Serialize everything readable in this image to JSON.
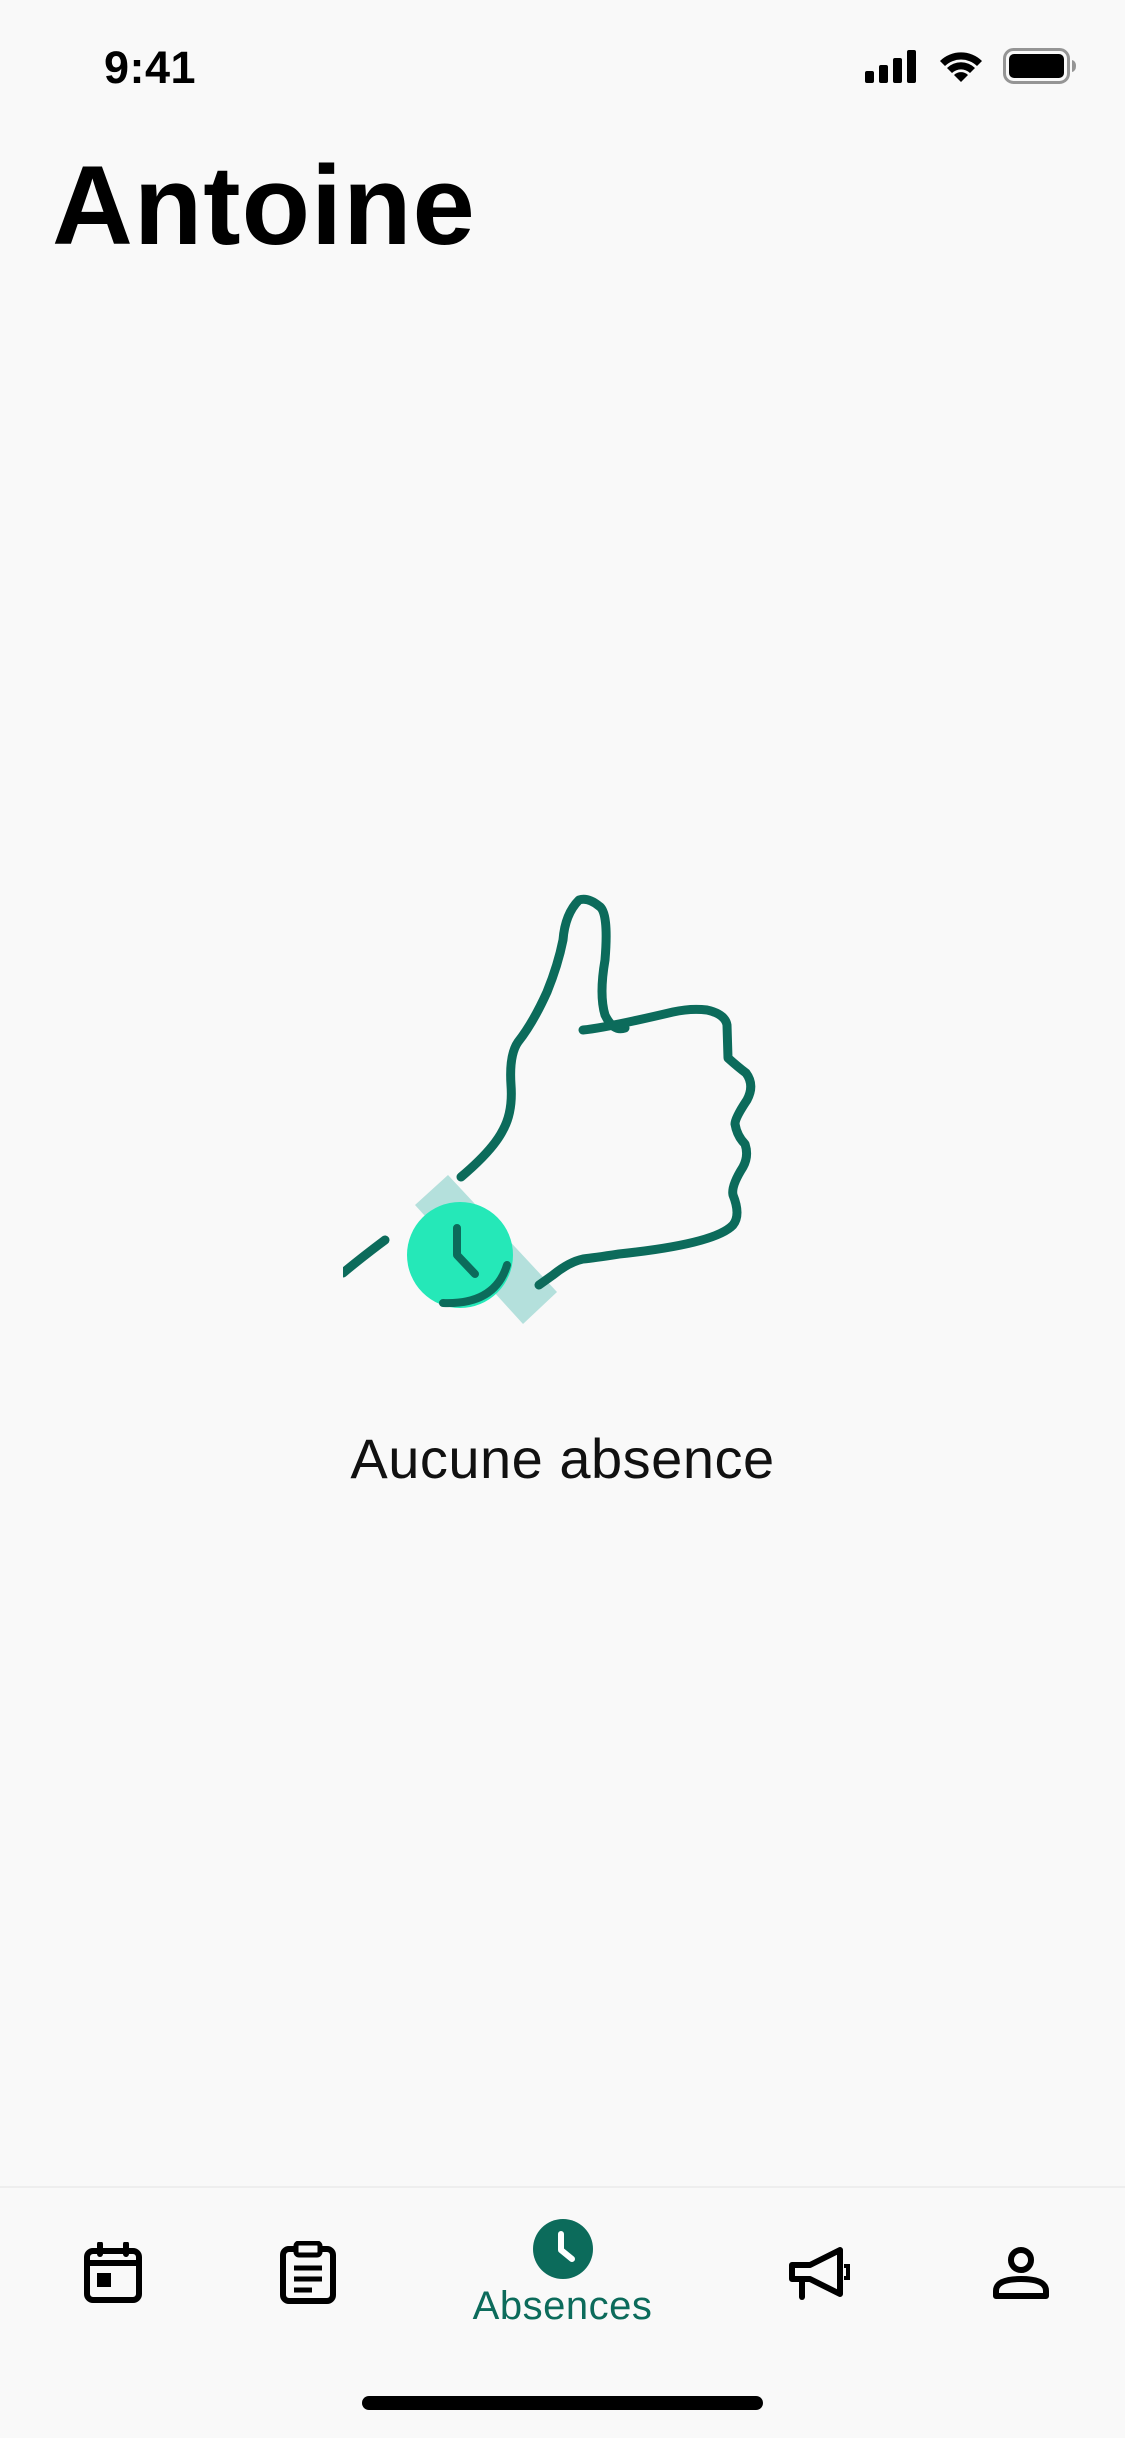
{
  "status_bar": {
    "time": "9:41",
    "icons": [
      "cellular-signal-icon",
      "wifi-icon",
      "battery-icon"
    ]
  },
  "page": {
    "title": "Antoine"
  },
  "empty_state": {
    "illustration": "thumbs-up-watch-illustration",
    "label": "Aucune absence"
  },
  "tab_bar": {
    "active_tab": "absences",
    "tabs": [
      {
        "id": "calendar",
        "icon": "calendar-icon",
        "label": ""
      },
      {
        "id": "notes",
        "icon": "clipboard-icon",
        "label": ""
      },
      {
        "id": "absences",
        "icon": "clock-icon",
        "label": "Absences"
      },
      {
        "id": "announcements",
        "icon": "megaphone-icon",
        "label": ""
      },
      {
        "id": "profile",
        "icon": "person-icon",
        "label": ""
      }
    ]
  },
  "colors": {
    "accent": "#0c6b5b",
    "accent_light": "#25e8b8",
    "accent_pale": "#b4e0dc",
    "background": "#f9f9f9"
  }
}
